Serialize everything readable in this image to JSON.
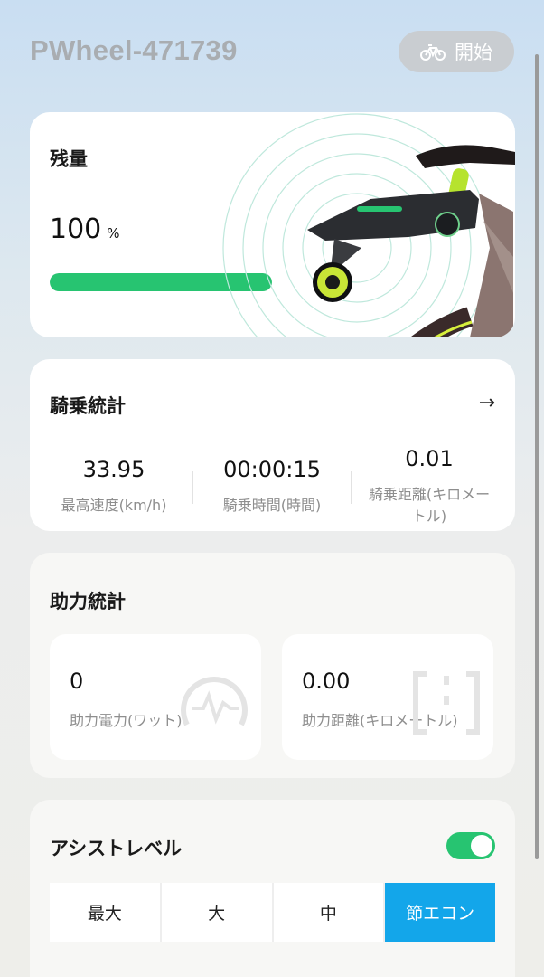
{
  "header": {
    "device_name": "PWheel-471739",
    "start_label": "開始",
    "start_icon": "bicycle-icon"
  },
  "battery": {
    "heading": "残量",
    "value": "100",
    "unit": "%",
    "level_percent": 100
  },
  "ride_stats": {
    "heading": "騎乗統計",
    "arrow_icon": "arrow-right-icon",
    "items": [
      {
        "value": "33.95",
        "label": "最高速度(km/h)"
      },
      {
        "value": "00:00:15",
        "label": "騎乗時間(時間)"
      },
      {
        "value": "0.01",
        "label": "騎乗距離(キロメートル)"
      }
    ]
  },
  "assist_stats": {
    "heading": "助力統計",
    "items": [
      {
        "value": "0",
        "label": "助力電力(ワット)",
        "icon": "power-gauge-icon"
      },
      {
        "value": "0.00",
        "label": "助力距離(キロメートル)",
        "icon": "distance-icon"
      }
    ]
  },
  "assist_level": {
    "heading": "アシストレベル",
    "enabled": true,
    "options": [
      "最大",
      "大",
      "中",
      "節エコン"
    ],
    "selected": "節エコン"
  },
  "colors": {
    "accent_green": "#27c471",
    "accent_blue": "#13a6ea",
    "muted_title": "#a9adb1"
  }
}
